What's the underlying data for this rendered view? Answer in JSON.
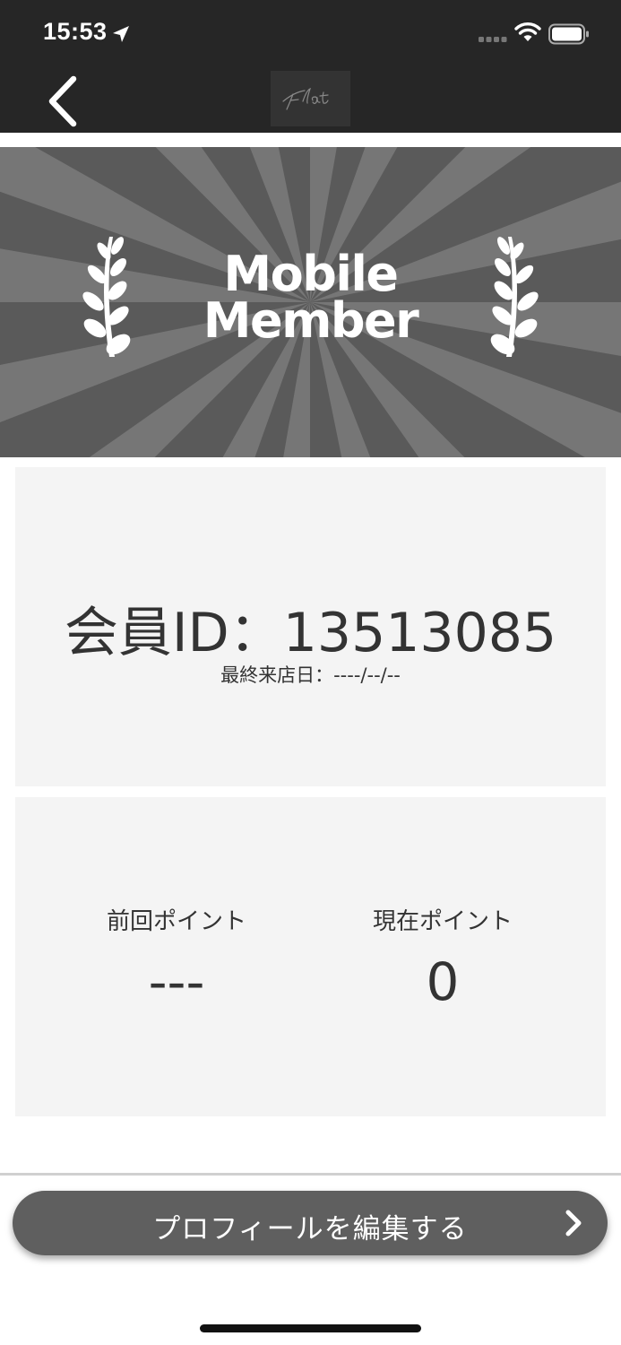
{
  "status_bar": {
    "time": "15:53",
    "icons": [
      "location-arrow-icon",
      "cellular-signal-icon",
      "wifi-icon",
      "battery-icon"
    ]
  },
  "nav": {
    "back_icon": "chevron-left-icon",
    "logo_text": "flat"
  },
  "hero": {
    "title_line1": "Mobile",
    "title_line2": "Member",
    "icons": [
      "laurel-left-icon",
      "laurel-right-icon"
    ]
  },
  "member": {
    "id_label": "会員ID：13513085",
    "last_visit": "最終来店日：----/--/--"
  },
  "points": {
    "previous_label": "前回ポイント",
    "previous_value": "---",
    "current_label": "現在ポイント",
    "current_value": "0"
  },
  "footer": {
    "edit_profile_label": "プロフィールを編集する",
    "edit_icon": "chevron-right-icon"
  },
  "colors": {
    "bar_background": "#262626",
    "hero_background": "#5a5a5a",
    "card_background": "#f4f4f4",
    "button_background": "#5f5f5f",
    "text": "#333333"
  }
}
